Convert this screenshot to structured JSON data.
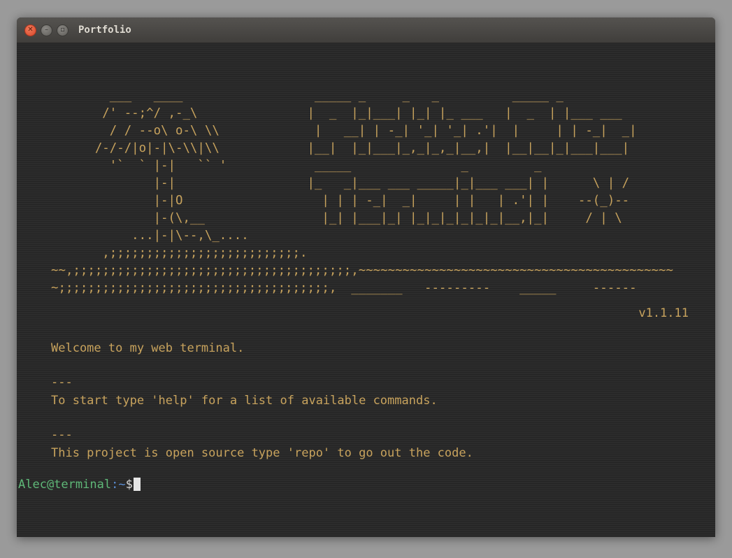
{
  "window": {
    "title": "Portfolio",
    "controls": {
      "close_icon": "close-icon",
      "minimize_icon": "minimize-icon",
      "maximize_icon": "maximize-icon"
    }
  },
  "terminal": {
    "banner_ascii": "        ___   ____                  _____ _     _   _          _____ _\n       /' --;^/ ,-_\\               |  _  |_|___| |_| |_ ___   |  _  | |___ ___\n        / / --o\\ o-\\ \\\\             |   __| | -_| '_| '_| .'|  |     | | -_|  _|\n      /-/-/|o|-|\\-\\\\|\\\\            |__|  |_|___|_,_|_,_|__,|  |__|__|_|___|___|\n        '`  ` |-|   `` '            _____               _         _\n              |-|                  |_   _|___ ___ _____|_|___ ___| |      \\ | /\n              |-|O                   | | | -_|  _|     | |   | .'| |    --(_)--\n              |-(\\,__                |_| |___|_| |_|_|_|_|_|_|__,|_|     / | \\\n           ...|-|\\--,\\_....\n       ,;;;;;;;;;;;;;;;;;;;;;;;;;;.\n~~,;;;;;;;;;;;;;;;;;;;;;;;;;;;;;;;;;;;;;;,~~~~~~~~~~~~~~~~~~~~~~~~~~~~~~~~~~~~~~~~~~~\n~;;;;;;;;;;;;;;;;;;;;;;;;;;;;;;;;;;;;;,  _______   ---------    _____     ------",
    "version": "v1.1.11",
    "welcome": "Welcome to my web terminal.",
    "separator_1": "---",
    "help_hint": "To start type 'help' for a list of available commands.",
    "separator_2": "---",
    "repo_hint": "This project is open source type 'repo' to go out the code.",
    "prompt": {
      "user_host": "Alec@terminal",
      "colon": ":",
      "path": "~",
      "symbol": "$",
      "input_value": ""
    }
  },
  "colors": {
    "background": "#2c2c2c",
    "text": "#c8a35d",
    "prompt_user": "#5fb878",
    "prompt_path": "#5b8fd6",
    "prompt_symbol": "#d6d6d6",
    "cursor": "#e6e6e6"
  }
}
